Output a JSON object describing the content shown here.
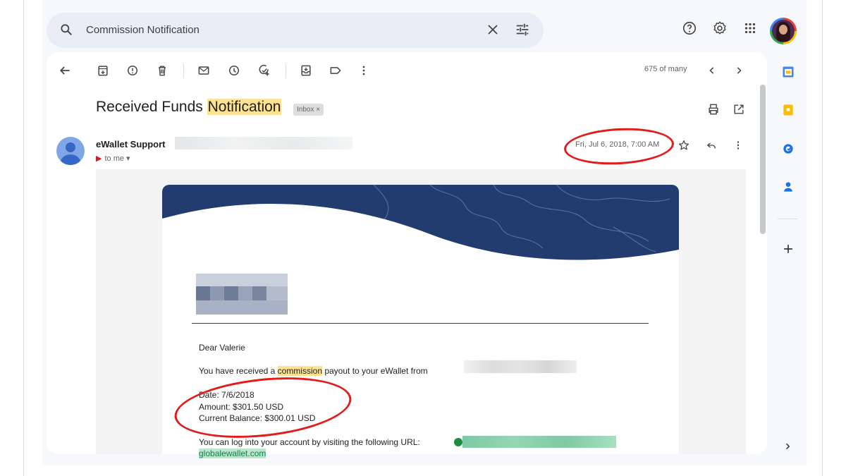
{
  "search": {
    "query": "Commission Notification"
  },
  "toolbar": {
    "pager": "675 of many"
  },
  "email": {
    "subject_pre": "Received Funds ",
    "subject_hl": "Notification",
    "label_chip": "Inbox ×",
    "sender": "eWallet Support",
    "to": "to me",
    "date": "Fri, Jul 6, 2018, 7:00 AM",
    "greeting": "Dear Valerie",
    "line1_pre": "You have received a ",
    "line1_hl": "commission",
    "line1_post": " payout to your eWallet from",
    "date_line": "Date: 7/6/2018",
    "amount_line": "Amount: $301.50 USD",
    "balance_line": "Current Balance: $300.01 USD",
    "login_line": "You can log into your account by visiting the following URL:",
    "url_partial": "globalewallet.com"
  },
  "colors": {
    "highlight": "#fde293",
    "annotation": "#e21b1b",
    "banner": "#1f3a6b"
  }
}
